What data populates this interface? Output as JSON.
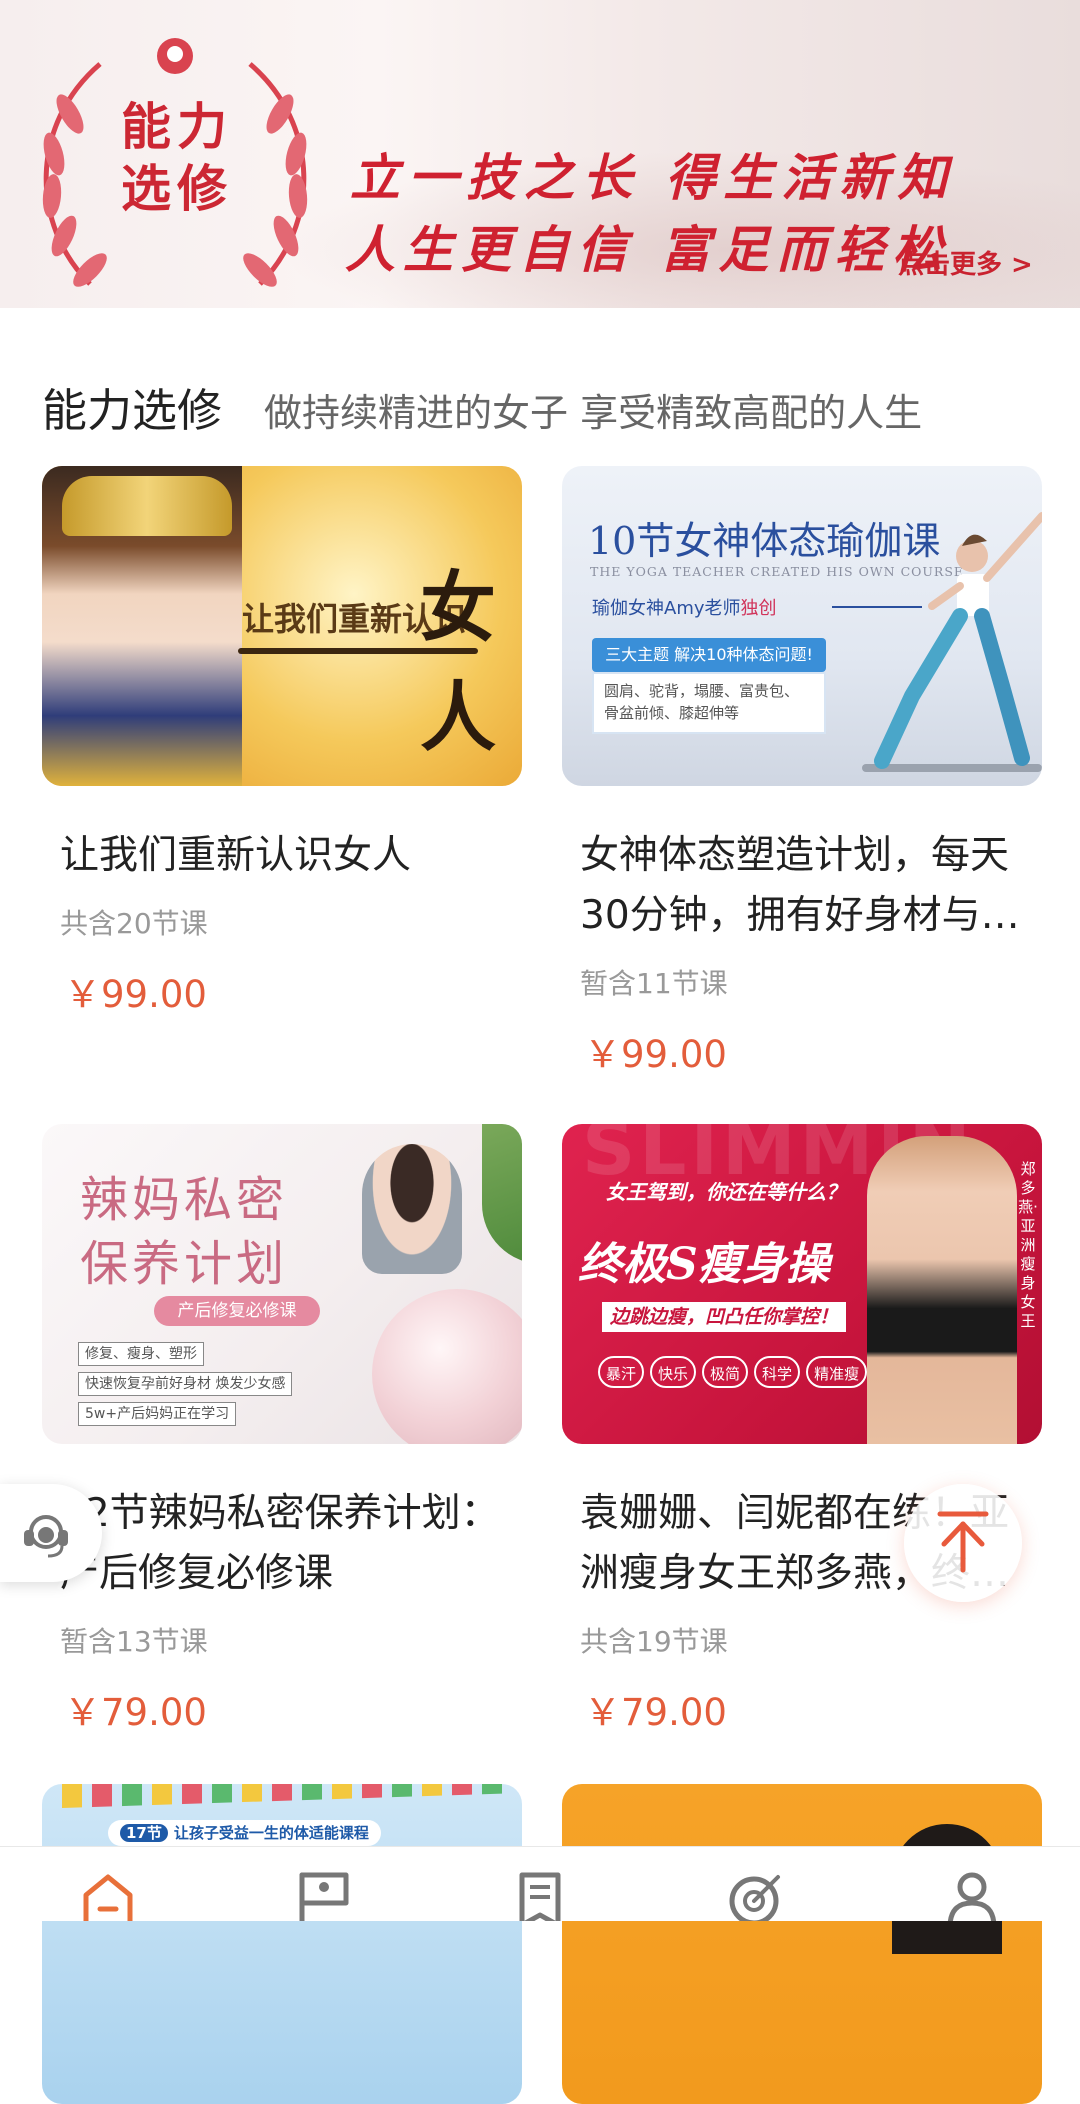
{
  "banner": {
    "wreath_text_line1": "能力",
    "wreath_text_line2": "选修",
    "slogan_line1": "立一技之长  得生活新知",
    "slogan_line2": "人生更自信  富足而轻松",
    "more_link": "点击更多 >"
  },
  "section": {
    "title": "能力选修",
    "subtitle": "做持续精进的女子 享受精致高配的人生"
  },
  "courses": [
    {
      "title": "让我们重新认识女人",
      "count": "共含20节课",
      "price": "￥99.00",
      "thumb": {
        "headline": "让我们重新认识",
        "big": "女人"
      }
    },
    {
      "title": "女神体态塑造计划，每天30分钟，拥有好身材与…",
      "count": "暂含11节课",
      "price": "￥99.00",
      "thumb": {
        "headline": "10节女神体态瑜伽课",
        "en": "THE YOGA TEACHER CREATED HIS OWN COURSE",
        "teacher": "瑜伽女神Amy老师",
        "teacher_tag": "独创",
        "pill": "三大主题 解决10种体态问题!",
        "box_line1": "圆肩、驼背，塌腰、富贵包、",
        "box_line2": "骨盆前倾、膝超伸等"
      }
    },
    {
      "title": "12节辣妈私密保养计划：产后修复必修课",
      "count": "暂含13节课",
      "price": "￥79.00",
      "thumb": {
        "h1": "辣妈私密",
        "h2": "保养计划",
        "ribbon": "产后修复必修课",
        "tag1": "修复、瘦身、塑形",
        "tag2": "快速恢复孕前好身材 焕发少女感",
        "tag3": "5w+产后妈妈正在学习"
      }
    },
    {
      "title": "袁姗姗、闫妮都在练！亚洲瘦身女王郑多燕，终…",
      "count": "共含19节课",
      "price": "￥79.00",
      "thumb": {
        "bgword": "SLIMMIN",
        "q": "女王驾到，你还在等什么？",
        "h": "终极S瘦身操",
        "sub": "边跳边瘦，凹凸任你掌控！",
        "chips": [
          "暴汗",
          "快乐",
          "极简",
          "科学",
          "精准瘦"
        ],
        "vertical": "郑多燕·亚洲瘦身女王"
      }
    },
    {
      "thumb": {
        "badge": "17节",
        "label": "让孩子受益一生的体适能课程"
      }
    },
    {
      "thumb": {}
    }
  ],
  "floating": {
    "service_icon": "headset-icon",
    "top_icon": "arrow-up-icon",
    "accent": "#e85a3c"
  },
  "tabbar": {
    "icons": [
      "home-icon",
      "flag-icon",
      "list-icon",
      "target-icon",
      "user-icon"
    ],
    "active_color": "#e8703a",
    "inactive_color": "#777777"
  }
}
